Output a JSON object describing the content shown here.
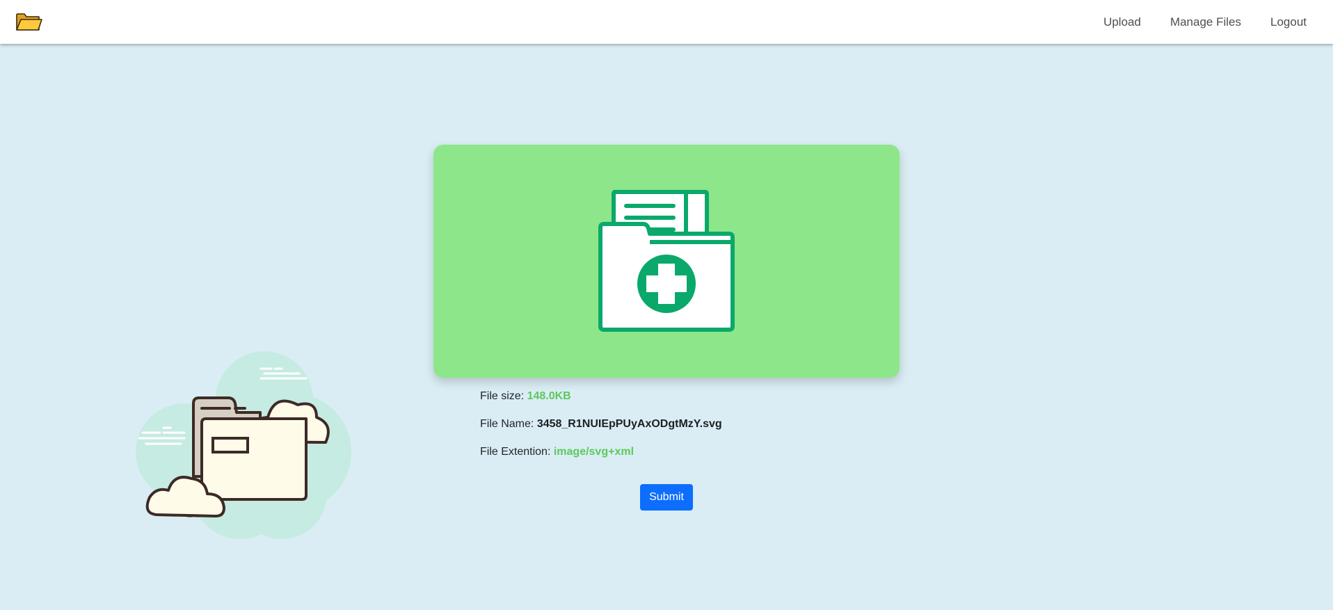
{
  "navbar": {
    "logo_icon": "open-folder-icon",
    "links": [
      {
        "label": "Upload"
      },
      {
        "label": "Manage Files"
      },
      {
        "label": "Logout"
      }
    ]
  },
  "illustration": {
    "icon": "cloud-folder-illustration"
  },
  "preview": {
    "icon": "medical-folder-icon",
    "background_color": "#8ee68a",
    "icon_color": "#0aa96b"
  },
  "file_info": {
    "size_label": "File size:",
    "size_value": "148.0KB",
    "name_label": "File Name:",
    "name_value": "3458_R1NUIEpPUyAxODgtMzY.svg",
    "ext_label": "File Extention:",
    "ext_value": "image/svg+xml"
  },
  "actions": {
    "submit_label": "Submit"
  },
  "colors": {
    "page_background": "#daedf4",
    "accent": "#0d6efd",
    "value_green": "#5cc95a"
  }
}
